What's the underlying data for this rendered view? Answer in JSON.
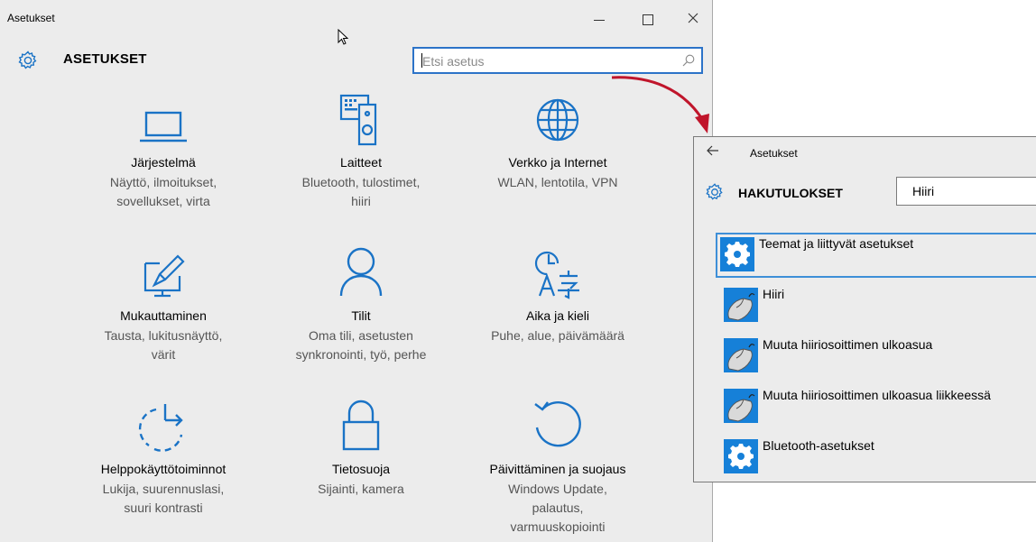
{
  "window": {
    "title": "Asetukset",
    "controls": [
      "minimize-icon",
      "maximize-icon",
      "close-icon"
    ]
  },
  "header": {
    "title": "ASETUKSET",
    "icon": "gear-icon"
  },
  "search": {
    "placeholder": "Etsi asetus",
    "icon": "search-icon"
  },
  "tiles": [
    {
      "name": "Järjestelmä",
      "desc1": "Näyttö, ilmoitukset,",
      "desc2": "sovellukset, virta",
      "desc3": "",
      "icon": "laptop-icon"
    },
    {
      "name": "Laitteet",
      "desc1": "Bluetooth, tulostimet,",
      "desc2": "hiiri",
      "desc3": "",
      "icon": "devices-icon"
    },
    {
      "name": "Verkko ja Internet",
      "desc1": "WLAN, lentotila, VPN",
      "desc2": "",
      "desc3": "",
      "icon": "globe-icon"
    },
    {
      "name": "Mukauttaminen",
      "desc1": "Tausta, lukitusnäyttö,",
      "desc2": "värit",
      "desc3": "",
      "icon": "personalization-icon"
    },
    {
      "name": "Tilit",
      "desc1": "Oma tili, asetusten",
      "desc2": "synkronointi, työ, perhe",
      "desc3": "",
      "icon": "person-icon"
    },
    {
      "name": "Aika ja kieli",
      "desc1": "Puhe, alue, päivämäärä",
      "desc2": "",
      "desc3": "",
      "icon": "time-language-icon"
    },
    {
      "name": "Helppokäyttötoiminnot",
      "desc1": "Lukija, suurennuslasi,",
      "desc2": "suuri kontrasti",
      "desc3": "",
      "icon": "ease-of-access-icon"
    },
    {
      "name": "Tietosuoja",
      "desc1": "Sijainti, kamera",
      "desc2": "",
      "desc3": "",
      "icon": "lock-icon"
    },
    {
      "name": "Päivittäminen ja suojaus",
      "desc1": "Windows Update,",
      "desc2": "palautus,",
      "desc3": "varmuuskopiointi",
      "icon": "update-icon"
    }
  ],
  "results_window": {
    "title": "Asetukset",
    "back_icon": "back-arrow-icon",
    "heading": "HAKUTULOKSET",
    "query": "Hiiri",
    "items": [
      {
        "label": "Teemat ja liittyvät asetukset",
        "icon": "gear-icon",
        "selected": true
      },
      {
        "label": "Hiiri",
        "icon": "mouse-icon",
        "selected": false
      },
      {
        "label": "Muuta hiiriosoittimen ulkoasua",
        "icon": "mouse-icon",
        "selected": false
      },
      {
        "label": "Muuta hiiriosoittimen ulkoasua liikkeessä",
        "icon": "mouse-icon",
        "selected": false
      },
      {
        "label": "Bluetooth-asetukset",
        "icon": "gear-icon",
        "selected": false
      }
    ]
  },
  "colors": {
    "accent": "#2c73c8",
    "tile_icon": "#1a73c6",
    "result_icon_bg": "#1680d8",
    "arrow": "#c0152b",
    "background": "#ececec"
  }
}
